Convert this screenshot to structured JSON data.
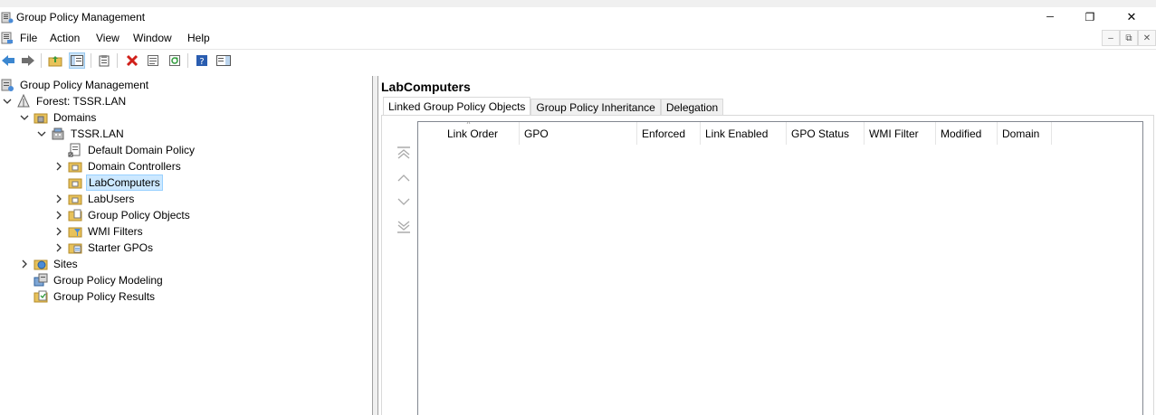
{
  "window": {
    "title": "Group Policy Management",
    "min_glyph": "─",
    "max_glyph": "❐",
    "close_glyph": "✕"
  },
  "menu": {
    "items": [
      "File",
      "Action",
      "View",
      "Window",
      "Help"
    ],
    "mdi_min": "–",
    "mdi_restore": "⧉",
    "mdi_close": "✕"
  },
  "tree": {
    "root": "Group Policy Management",
    "forest": "Forest: TSSR.LAN",
    "domains": "Domains",
    "domain": "TSSR.LAN",
    "default_policy": "Default Domain Policy",
    "domain_controllers": "Domain Controllers",
    "lab_computers": "LabComputers",
    "lab_users": "LabUsers",
    "gpo": "Group Policy Objects",
    "wmi": "WMI Filters",
    "starter": "Starter GPOs",
    "sites": "Sites",
    "modeling": "Group Policy Modeling",
    "results": "Group Policy Results"
  },
  "right": {
    "header": "LabComputers",
    "tabs": [
      "Linked Group Policy Objects",
      "Group Policy Inheritance",
      "Delegation"
    ],
    "columns": [
      "Link Order",
      "GPO",
      "Enforced",
      "Link Enabled",
      "GPO Status",
      "WMI Filter",
      "Modified",
      "Domain"
    ],
    "sort_glyph": "^"
  },
  "colors": {
    "selection_bg": "#cce8ff",
    "selection_border": "#99d1ff",
    "folder": "#e8c25a"
  }
}
